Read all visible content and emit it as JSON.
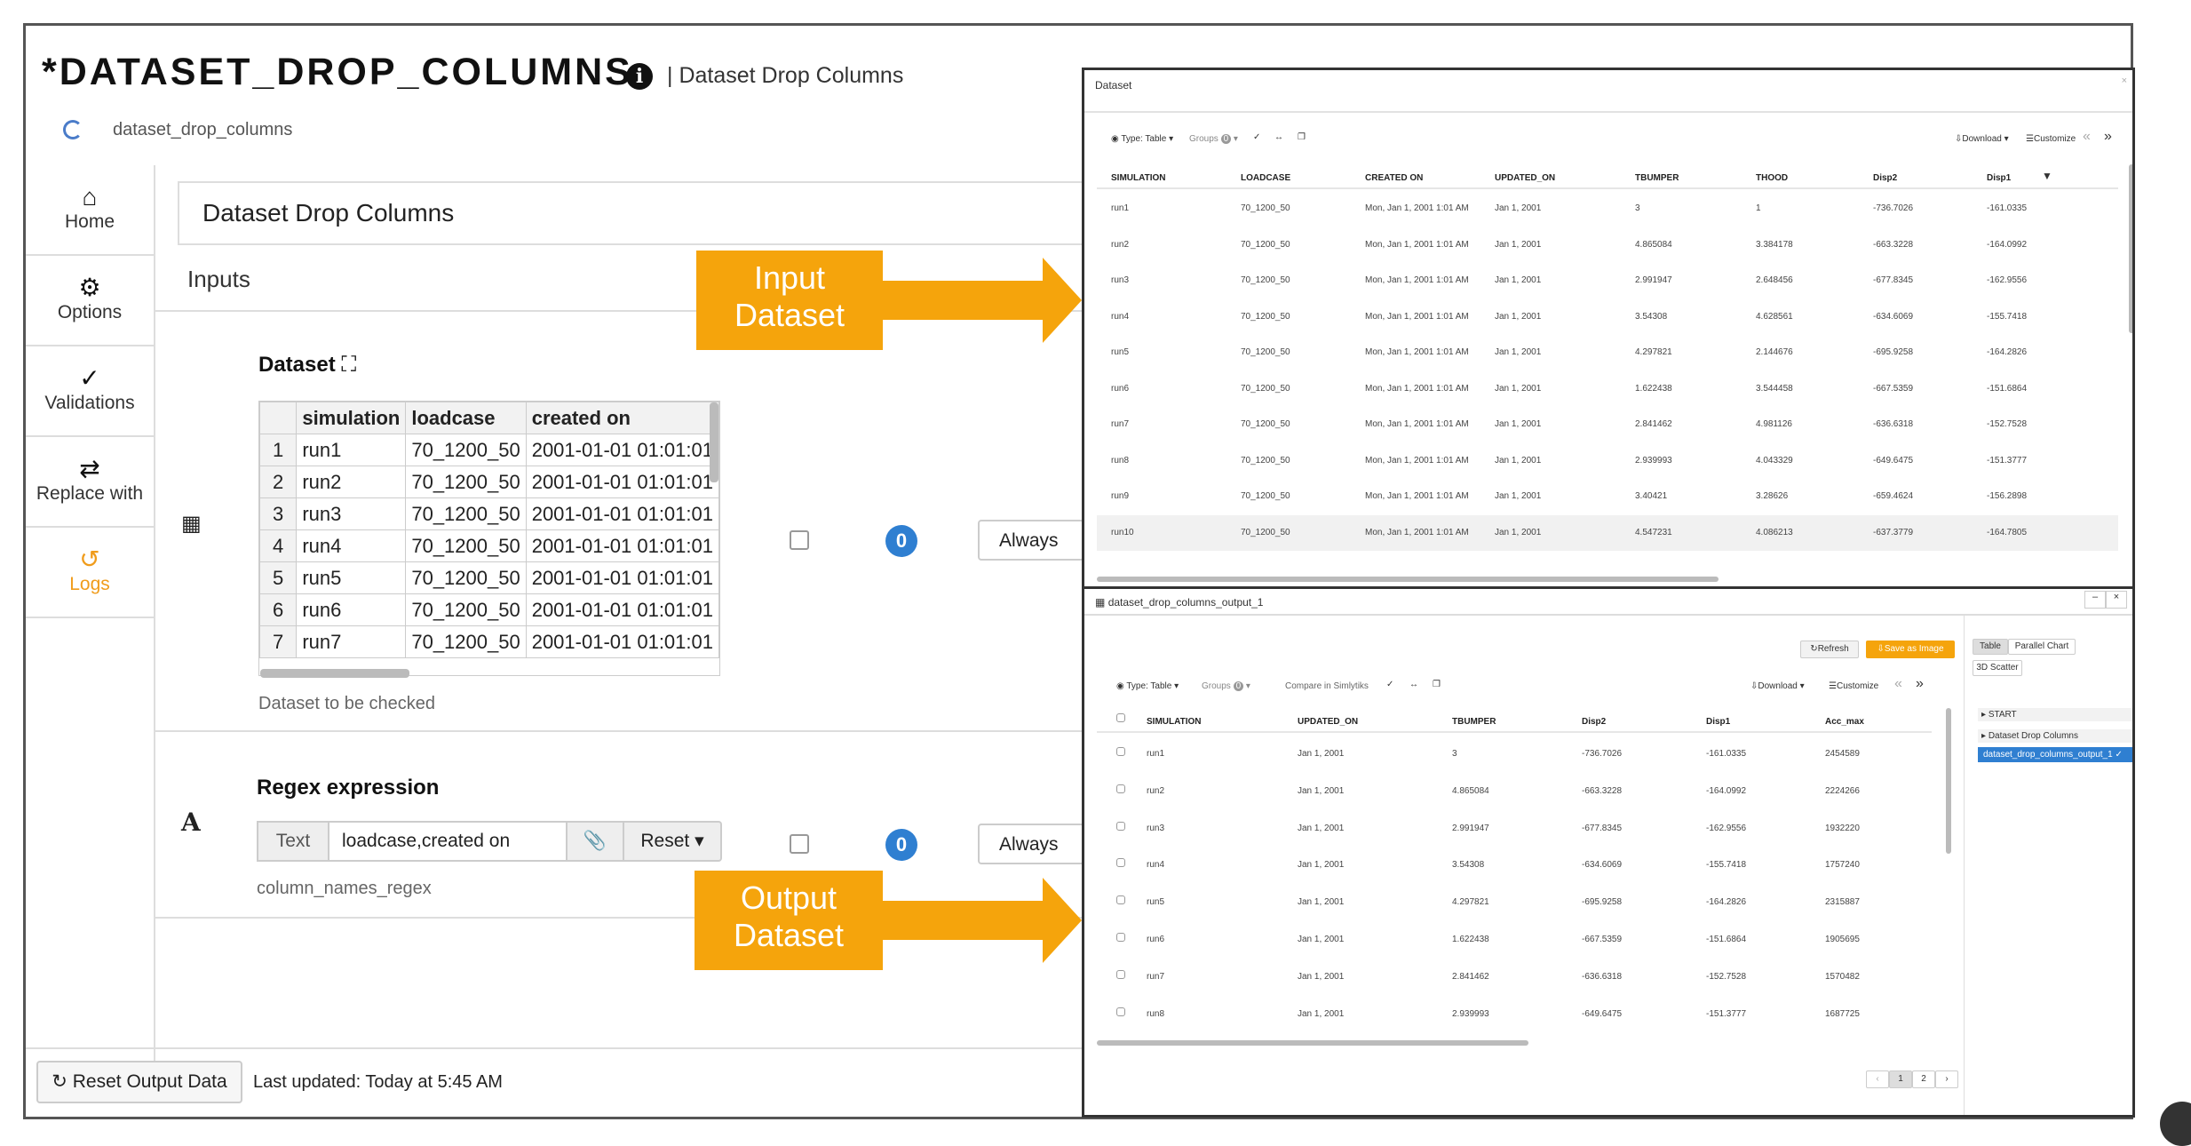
{
  "app": {
    "title": "*DATASET_DROP_COLUMNS",
    "subtitle": "| Dataset Drop Columns",
    "node_name": "dataset_drop_columns"
  },
  "sidebar": {
    "items": [
      {
        "label": "Home",
        "icon": "home-icon"
      },
      {
        "label": "Options",
        "icon": "gear-icon"
      },
      {
        "label": "Validations",
        "icon": "double-check-icon"
      },
      {
        "label": "Replace with",
        "icon": "swap-icon"
      },
      {
        "label": "Logs",
        "icon": "history-icon",
        "active": true
      }
    ]
  },
  "main": {
    "node_title": "Dataset Drop Columns",
    "inputs_label": "Inputs",
    "dataset_param": {
      "title": "Dataset",
      "description": "Dataset to be checked",
      "badge": "0",
      "condition": "Always",
      "columns": [
        "simulation",
        "loadcase",
        "created on"
      ],
      "rows": [
        [
          "1",
          "run1",
          "70_1200_50",
          "2001-01-01 01:01:01"
        ],
        [
          "2",
          "run2",
          "70_1200_50",
          "2001-01-01 01:01:01"
        ],
        [
          "3",
          "run3",
          "70_1200_50",
          "2001-01-01 01:01:01"
        ],
        [
          "4",
          "run4",
          "70_1200_50",
          "2001-01-01 01:01:01"
        ],
        [
          "5",
          "run5",
          "70_1200_50",
          "2001-01-01 01:01:01"
        ],
        [
          "6",
          "run6",
          "70_1200_50",
          "2001-01-01 01:01:01"
        ],
        [
          "7",
          "run7",
          "70_1200_50",
          "2001-01-01 01:01:01"
        ]
      ]
    },
    "regex_param": {
      "title": "Regex expression",
      "description": "column_names_regex",
      "prefix": "Text",
      "value": "loadcase,created on",
      "reset_label": "Reset",
      "badge": "0",
      "condition": "Always"
    },
    "footer": {
      "reset_label": "Reset Output Data",
      "last_updated": "Last updated: Today at 5:45 AM"
    }
  },
  "annotations": {
    "input_arrow": [
      "Input",
      "Dataset"
    ],
    "output_arrow": [
      "Output",
      "Dataset"
    ]
  },
  "input_window": {
    "title": "Dataset",
    "toolbar": {
      "type": "Type: Table",
      "groups": "Groups",
      "groups_count": "0",
      "download": "Download",
      "customize": "Customize"
    },
    "columns": [
      "SIMULATION",
      "LOADCASE",
      "CREATED ON",
      "UPDATED_ON",
      "TBUMPER",
      "THOOD",
      "Disp2",
      "Disp1"
    ],
    "rows": [
      [
        "run1",
        "70_1200_50",
        "Mon, Jan 1, 2001 1:01 AM",
        "Jan 1, 2001",
        "3",
        "1",
        "-736.7026",
        "-161.0335"
      ],
      [
        "run2",
        "70_1200_50",
        "Mon, Jan 1, 2001 1:01 AM",
        "Jan 1, 2001",
        "4.865084",
        "3.384178",
        "-663.3228",
        "-164.0992"
      ],
      [
        "run3",
        "70_1200_50",
        "Mon, Jan 1, 2001 1:01 AM",
        "Jan 1, 2001",
        "2.991947",
        "2.648456",
        "-677.8345",
        "-162.9556"
      ],
      [
        "run4",
        "70_1200_50",
        "Mon, Jan 1, 2001 1:01 AM",
        "Jan 1, 2001",
        "3.54308",
        "4.628561",
        "-634.6069",
        "-155.7418"
      ],
      [
        "run5",
        "70_1200_50",
        "Mon, Jan 1, 2001 1:01 AM",
        "Jan 1, 2001",
        "4.297821",
        "2.144676",
        "-695.9258",
        "-164.2826"
      ],
      [
        "run6",
        "70_1200_50",
        "Mon, Jan 1, 2001 1:01 AM",
        "Jan 1, 2001",
        "1.622438",
        "3.544458",
        "-667.5359",
        "-151.6864"
      ],
      [
        "run7",
        "70_1200_50",
        "Mon, Jan 1, 2001 1:01 AM",
        "Jan 1, 2001",
        "2.841462",
        "4.981126",
        "-636.6318",
        "-152.7528"
      ],
      [
        "run8",
        "70_1200_50",
        "Mon, Jan 1, 2001 1:01 AM",
        "Jan 1, 2001",
        "2.939993",
        "4.043329",
        "-649.6475",
        "-151.3777"
      ],
      [
        "run9",
        "70_1200_50",
        "Mon, Jan 1, 2001 1:01 AM",
        "Jan 1, 2001",
        "3.40421",
        "3.28626",
        "-659.4624",
        "-156.2898"
      ],
      [
        "run10",
        "70_1200_50",
        "Mon, Jan 1, 2001 1:01 AM",
        "Jan 1, 2001",
        "4.547231",
        "4.086213",
        "-637.3779",
        "-164.7805"
      ]
    ]
  },
  "output_window": {
    "title": "dataset_drop_columns_output_1",
    "refresh_label": "Refresh",
    "save_label": "Save as Image",
    "toolbar": {
      "type": "Type: Table",
      "groups": "Groups",
      "groups_count": "0",
      "compare": "Compare in Simlytiks",
      "download": "Download",
      "customize": "Customize"
    },
    "columns": [
      "SIMULATION",
      "UPDATED_ON",
      "TBUMPER",
      "Disp2",
      "Disp1",
      "Acc_max"
    ],
    "rows": [
      [
        "run1",
        "Jan 1, 2001",
        "3",
        "-736.7026",
        "-161.0335",
        "2454589"
      ],
      [
        "run2",
        "Jan 1, 2001",
        "4.865084",
        "-663.3228",
        "-164.0992",
        "2224266"
      ],
      [
        "run3",
        "Jan 1, 2001",
        "2.991947",
        "-677.8345",
        "-162.9556",
        "1932220"
      ],
      [
        "run4",
        "Jan 1, 2001",
        "3.54308",
        "-634.6069",
        "-155.7418",
        "1757240"
      ],
      [
        "run5",
        "Jan 1, 2001",
        "4.297821",
        "-695.9258",
        "-164.2826",
        "2315887"
      ],
      [
        "run6",
        "Jan 1, 2001",
        "1.622438",
        "-667.5359",
        "-151.6864",
        "1905695"
      ],
      [
        "run7",
        "Jan 1, 2001",
        "2.841462",
        "-636.6318",
        "-152.7528",
        "1570482"
      ],
      [
        "run8",
        "Jan 1, 2001",
        "2.939993",
        "-649.6475",
        "-151.3777",
        "1687725"
      ]
    ],
    "view_tabs": [
      "Table",
      "Parallel Chart",
      "3D Scatter"
    ],
    "flow_items": [
      "START",
      "Dataset Drop Columns",
      "dataset_drop_columns_output_1"
    ],
    "pages": [
      "1",
      "2"
    ],
    "prev": "‹",
    "next": "›"
  },
  "colors": {
    "accent": "#f5a40c",
    "badge": "#2f7fd1",
    "active": "#f09c1b"
  }
}
